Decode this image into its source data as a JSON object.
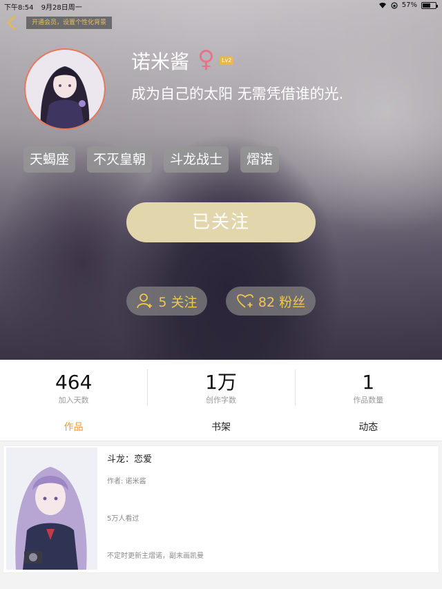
{
  "status_bar": {
    "time": "下午8:54",
    "date": "9月28日周一",
    "battery": "57%"
  },
  "header": {
    "back_icon": "chevron-left-icon",
    "vip_tip": "开通会员，设置个性化背景"
  },
  "profile": {
    "name": "诺米酱",
    "gender_symbol": "♀",
    "level": "Lv2",
    "bio": "成为自己的太阳  无需凭借谁的光.",
    "tags": [
      "天蝎座",
      "不灭皇朝",
      "斗龙战士",
      "熠诺"
    ],
    "follow_button": "已关注",
    "following_label": "5 关注",
    "fans_label": "82 粉丝"
  },
  "stats": [
    {
      "value": "464",
      "label": "加入天数"
    },
    {
      "value": "1万",
      "label": "创作字数"
    },
    {
      "value": "1",
      "label": "作品数量"
    }
  ],
  "tabs": [
    {
      "label": "作品",
      "active": true
    },
    {
      "label": "书架",
      "active": false
    },
    {
      "label": "动态",
      "active": false
    }
  ],
  "works": [
    {
      "title": "斗龙：恋爱",
      "author": "作者: 诺米酱",
      "views": "5万人看过",
      "description": "不定时更新主熠诺，副末画凯曼"
    }
  ],
  "colors": {
    "accent_tab": "#f09a45",
    "follow_button": "#e2d6ad",
    "pill_text": "#f2c84c",
    "gender": "#e9728a",
    "level_badge": "#e8b94a",
    "vip_tip_text": "#e8c15a"
  }
}
